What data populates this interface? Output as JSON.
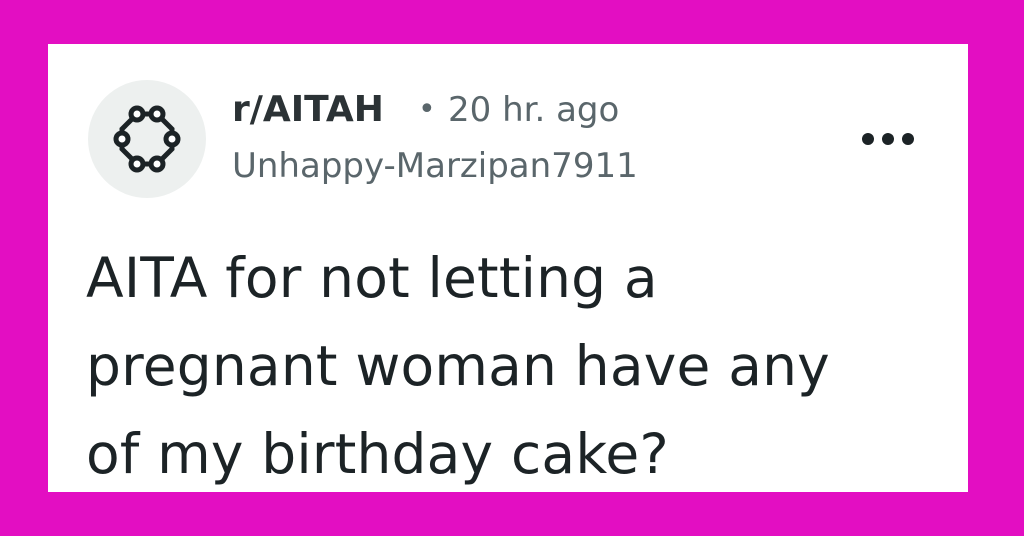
{
  "background_color": "#e30ec2",
  "post": {
    "subreddit": "r/AITAH",
    "separator": "•",
    "time_ago": "20 hr. ago",
    "username": "Unhappy-Marzipan7911",
    "avatar_icon": "subreddit-snoo-ring-icon",
    "more_icon": "ellipsis-icon",
    "title_lines": [
      "AITA for not letting a",
      "pregnant woman have any",
      "of my birthday cake?"
    ]
  }
}
